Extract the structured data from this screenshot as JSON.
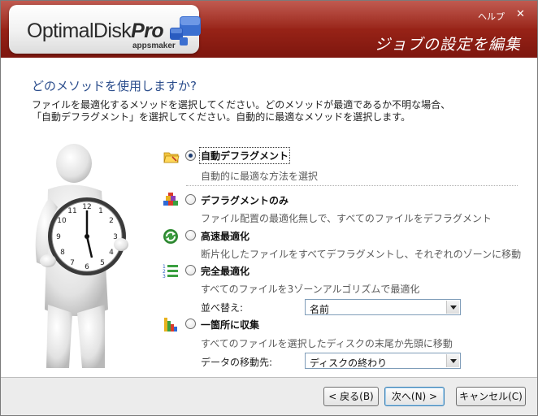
{
  "header": {
    "logo_main": "OptimalDisk",
    "logo_bold": "Pro",
    "logo_sub": "appsmaker",
    "help": "ヘルプ",
    "close": "✕",
    "title": "ジョブの設定を編集"
  },
  "question": "どのメソッドを使用しますか?",
  "description": [
    "ファイルを最適化するメソッドを選択してください。どのメソッドが最適であるか不明な場合、",
    "「自動デフラグメント」を選択してください。自動的に最適なメソッドを選択します。"
  ],
  "options": [
    {
      "label": "自動デフラグメント",
      "desc": "自動的に最適な方法を選択",
      "selected": true,
      "icon": "folder-icon"
    },
    {
      "label": "デフラグメントのみ",
      "desc": "ファイル配置の最適化無しで、すべてのファイルをデフラグメント",
      "selected": false,
      "icon": "blocks-icon"
    },
    {
      "label": "高速最適化",
      "desc": "断片化したファイルをすべてデフラグメントし、それぞれのゾーンに移動",
      "selected": false,
      "icon": "refresh-icon"
    },
    {
      "label": "完全最適化",
      "desc": "すべてのファイルを3ゾーンアルゴリズムで最適化",
      "selected": false,
      "icon": "numbered-list-icon"
    },
    {
      "label": "一箇所に収集",
      "desc": "すべてのファイルを選択したディスクの末尾か先頭に移動",
      "selected": false,
      "icon": "stack-icon"
    }
  ],
  "sort": {
    "label": "並べ替え:",
    "value": "名前"
  },
  "destination": {
    "label": "データの移動先:",
    "value": "ディスクの終わり"
  },
  "buttons": {
    "back": "< 戻る(B)",
    "next": "次へ(N) >",
    "cancel": "キャンセル(C)"
  },
  "colors": {
    "header": "#9a2418",
    "question": "#2b4d8c",
    "focus_border": "#3c7fb1"
  }
}
